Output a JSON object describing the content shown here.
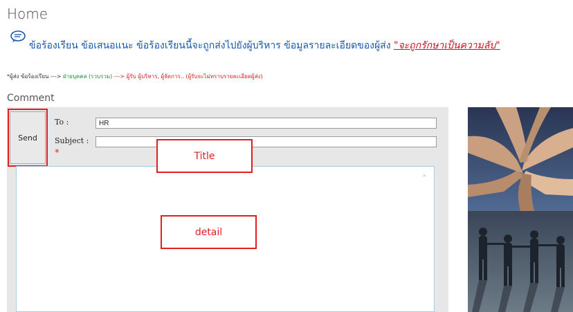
{
  "page": {
    "title": "Home"
  },
  "notice": {
    "icon": "speech-bubble-icon",
    "text": "ข้อร้องเรียน ข้อเสนอแนะ ข้อร้องเรียนนี้จะถูกส่งไปยังผู้บริหาร  ข้อมูลรายละเอียดของผู้ส่ง ",
    "highlight": "\"จะถูกรักษาเป็นความลับ\""
  },
  "flow": {
    "part1": "*ผู้ส่ง ข้อร้องเรียน --->",
    "part2": " ฝ่ายบุคคล (รวบรวม) ",
    "part3": "---> ผู้รับ ผู้บริหาร, ผู้จัดการ.. (ผู้รับจะไม่ทราบรายละเอียดผู้ส่ง)"
  },
  "comment": {
    "heading": "Comment",
    "send_label": "Send",
    "to_label": "To :",
    "to_value": "HR",
    "subject_label": "Subject :",
    "subject_value": "",
    "required_mark": "*",
    "detail_value": ""
  },
  "annotations": {
    "title": "Title",
    "detail": "detail"
  },
  "colors": {
    "accent_blue": "#1a57a8",
    "annotation_red": "#e01e1e",
    "panel_gray": "#e7e7e7"
  }
}
